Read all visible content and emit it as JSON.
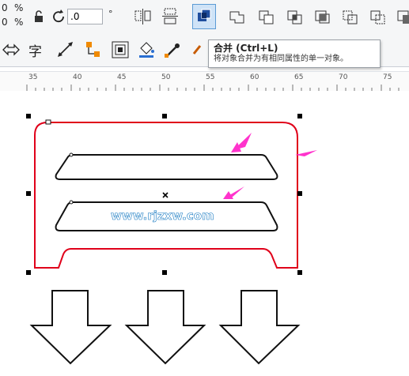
{
  "toolbar": {
    "percent_top": "%",
    "percent_bottom": "%",
    "left_value_top": "0",
    "left_value_bottom": "0",
    "rotation_value": ".0",
    "degree_symbol": "°",
    "char_tool_glyph": "字",
    "icons": [
      "lock-icon",
      "rotate-icon",
      "mirror-horizontal-icon",
      "mirror-vertical-icon",
      "combine-icon",
      "weld-icon",
      "trim-icon",
      "intersect-icon",
      "simplify-icon",
      "front-minus-back-icon"
    ]
  },
  "tooltip": {
    "title": "合并 (Ctrl+L)",
    "description": "将对象合并为有相同属性的单一对象。"
  },
  "ruler": {
    "labels": [
      "35",
      "40",
      "45",
      "50",
      "55",
      "60",
      "65",
      "70",
      "75"
    ]
  },
  "canvas": {
    "watermark": "www.rjzxw.com",
    "colors": {
      "outline": "#e0001a",
      "arrow_annotation": "#ff33cc",
      "selection_handle": "#000000"
    }
  }
}
